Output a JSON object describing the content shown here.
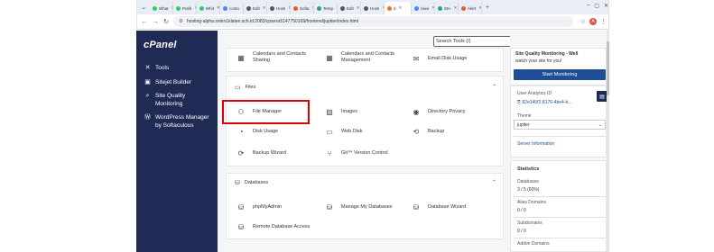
{
  "browser": {
    "tabs": [
      {
        "label": "What",
        "color": "#25d366"
      },
      {
        "label": "Putih",
        "color": "#25d366"
      },
      {
        "label": "Whit",
        "color": "#25d366"
      },
      {
        "label": "conto",
        "color": "#4285f4"
      },
      {
        "label": "Edit",
        "color": "#555555"
      },
      {
        "label": "Hosti",
        "color": "#555555"
      },
      {
        "label": "Softa",
        "color": "#e35d2b"
      },
      {
        "label": "Temp",
        "color": "#2a9d8f"
      },
      {
        "label": "Edit",
        "color": "#555555"
      },
      {
        "label": "Hosti",
        "color": "#555555"
      },
      {
        "label": "d",
        "color": "#ff6c2c",
        "active": true
      },
      {
        "label": "lowo",
        "color": "#4285f4"
      },
      {
        "label": "29+",
        "color": "#2a9d8f"
      },
      {
        "label": "Alert",
        "color": "#e35d2b"
      }
    ],
    "new_tab": "+",
    "url": "hosting-alpha.smkn1klaten.sch.id:2083/cpsess5147750169/frontend/jupiter/index.html"
  },
  "sidebar": {
    "logo": "cPanel",
    "items": [
      {
        "label": "Tools",
        "icon": "tools-icon",
        "glyph": "✕"
      },
      {
        "label": "Sitejet Builder",
        "icon": "sitejet-icon",
        "glyph": "▣"
      },
      {
        "label": "Site Quality Monitoring",
        "icon": "site-quality-icon",
        "glyph": "⌕"
      },
      {
        "label": "WordPress Manager by Softaculous",
        "icon": "wordpress-icon",
        "glyph": "Ⓦ"
      }
    ]
  },
  "header": {
    "search_placeholder": "Search Tools (/)"
  },
  "main": {
    "top_items": [
      "Calendars and Contacts Sharing",
      "Calendars and Contacts Management",
      "Email Disk Usage"
    ],
    "files": {
      "title": "Files",
      "items": [
        "File Manager",
        "Images",
        "Directory Privacy",
        "Disk Usage",
        "Web Disk",
        "Backup",
        "Backup Wizard",
        "Git™ Version Control"
      ]
    },
    "databases": {
      "title": "Databases",
      "items": [
        "phpMyAdmin",
        "Manage My Databases",
        "Database Wizard",
        "Remote Database Access"
      ]
    }
  },
  "right_panel": {
    "sqm_title": "Site Quality Monitoring - Well",
    "sqm_sub": "watch your site for you!",
    "sqm_button": "Start Monitoring",
    "user_analytics_label": "User Analytics ID",
    "user_analytics_value": "82e145f2-8176-4be4-b...",
    "theme_label": "Theme",
    "theme_value": "jupiter",
    "server_info": "Server Information",
    "statistics_title": "Statistics",
    "stats": [
      {
        "label": "Databases",
        "value": "3 / 5   (60%)"
      },
      {
        "label": "Alias Domains",
        "value": "0 / 0"
      },
      {
        "label": "Subdomains",
        "value": "0 / 0"
      },
      {
        "label": "Addon Domains",
        "value": ""
      }
    ]
  }
}
